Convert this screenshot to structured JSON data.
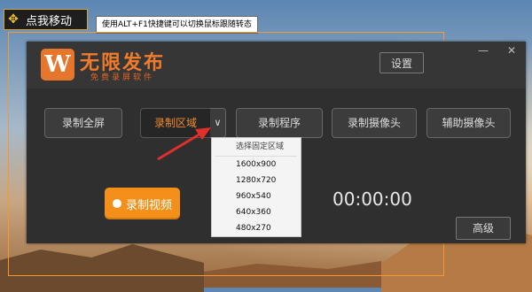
{
  "desktop": {
    "move_button": {
      "icon": "move-arrows-icon",
      "label": "点我移动"
    },
    "hint_text": "使用ALT+F1快捷键可以切换鼠标跟随转态"
  },
  "app": {
    "logo_letter": "W",
    "brand_name": "无限发布",
    "brand_subtitle": "免费录屏软件",
    "settings_label": "设置",
    "window_controls": {
      "minimize": "—",
      "close": "✕"
    },
    "mode_buttons": [
      {
        "label": "录制全屏",
        "active": false
      },
      {
        "label": "录制区域",
        "active": true
      },
      {
        "label": "录制程序",
        "active": false
      },
      {
        "label": "录制摄像头",
        "active": false
      },
      {
        "label": "辅助摄像头",
        "active": false
      }
    ],
    "dropdown_arrow": "∨",
    "record_button_label": "录制视频",
    "timer": "00:00:00",
    "advanced_label": "高级"
  },
  "region_menu": {
    "header": "选择固定区域",
    "options": [
      "1600x900",
      "1280x720",
      "960x540",
      "640x360",
      "480x270"
    ]
  },
  "colors": {
    "accent": "#f08a2d",
    "window_bg": "#2f2f2f",
    "record_button": "#f4901a",
    "annotation_arrow": "#e0302a",
    "outline_rect": "#f29a2f"
  }
}
